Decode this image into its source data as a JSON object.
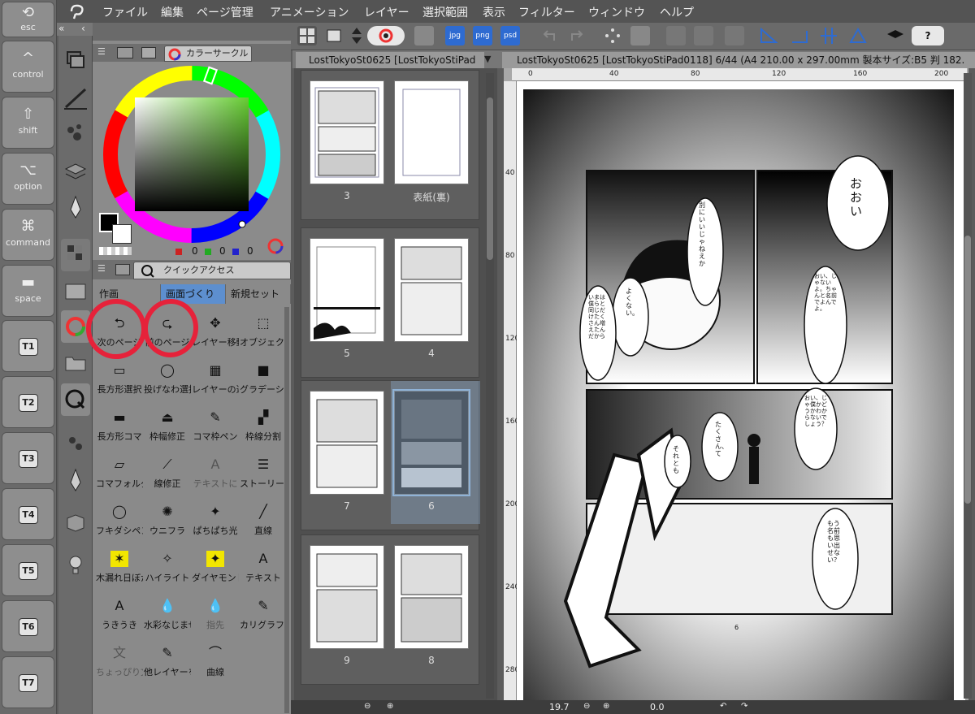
{
  "keys": [
    {
      "glyph": "⟲",
      "label": "esc"
    },
    {
      "glyph": "^",
      "label": "control"
    },
    {
      "glyph": "⇧",
      "label": "shift"
    },
    {
      "glyph": "⌥",
      "label": "option"
    },
    {
      "glyph": "⌘",
      "label": "command"
    },
    {
      "glyph": "▬",
      "label": "space"
    }
  ],
  "tkeys": [
    "T1",
    "T2",
    "T3",
    "T4",
    "T5",
    "T6",
    "T7"
  ],
  "menu": [
    "ファイル",
    "編集",
    "ページ管理",
    "アニメーション",
    "レイヤー",
    "選択範囲",
    "表示",
    "フィルター",
    "ウィンドウ",
    "ヘルプ"
  ],
  "color_panel": {
    "tab_label": "カラーサークル",
    "rgb": [
      "0",
      "0",
      "0"
    ],
    "colors": {
      "hue_ring_start": "#ff0000",
      "square_top_right": "#66cc33",
      "red": "#c22",
      "green": "#2a2",
      "blue": "#22c"
    }
  },
  "quick_access": {
    "tab_label": "クイックアクセス",
    "sets": [
      "作画",
      "画面づくり",
      "新規セット"
    ],
    "items": [
      {
        "icon": "prev-page-icon",
        "label": "次のページ"
      },
      {
        "icon": "next-page-icon",
        "label": "前のページ"
      },
      {
        "icon": "move-layer-icon",
        "label": "レイヤー移動"
      },
      {
        "icon": "object-icon",
        "label": "オブジェクト"
      },
      {
        "icon": "rect-select-icon",
        "label": "長方形選択"
      },
      {
        "icon": "lasso-select-icon",
        "label": "投げなわ選択"
      },
      {
        "icon": "layer-select-icon",
        "label": "レイヤーの選択"
      },
      {
        "icon": "gradient-icon",
        "label": "グラデーション"
      },
      {
        "icon": "rect-frame-icon",
        "label": "長方形コマ"
      },
      {
        "icon": "border-fix-icon",
        "label": "枠幅修正"
      },
      {
        "icon": "frame-pen-icon",
        "label": "コマ枠ペン"
      },
      {
        "icon": "frame-split-icon",
        "label": "枠線分割"
      },
      {
        "icon": "frame-folder-icon",
        "label": "コマフォルダー"
      },
      {
        "icon": "line-fix-icon",
        "label": "線修正"
      },
      {
        "icon": "text-icon",
        "label": "テキストに"
      },
      {
        "icon": "story-icon",
        "label": "ストーリーエディタ"
      },
      {
        "icon": "balloon-icon",
        "label": "フキダシペン"
      },
      {
        "icon": "uni-flash-icon",
        "label": "ウニフラ"
      },
      {
        "icon": "sparkle-icon",
        "label": "ぱちぱち光"
      },
      {
        "icon": "line-icon",
        "label": "直線"
      },
      {
        "icon": "leaf-light-icon",
        "label": "木漏れ日ぼかし"
      },
      {
        "icon": "highlight-icon",
        "label": "ハイライト"
      },
      {
        "icon": "diamond-icon",
        "label": "ダイヤモンド"
      },
      {
        "icon": "text-tool-icon",
        "label": "テキスト"
      },
      {
        "icon": "wobble-text-icon",
        "label": "うきうき"
      },
      {
        "icon": "watercolor-icon",
        "label": "水彩なじませ"
      },
      {
        "icon": "finger-icon",
        "label": "指先"
      },
      {
        "icon": "calligraphy-icon",
        "label": "カリグラフィ"
      },
      {
        "icon": "char-icon",
        "label": "ちょっぴり文字"
      },
      {
        "icon": "other-layer-icon",
        "label": "他レイヤーを"
      },
      {
        "icon": "curve-icon",
        "label": "曲線"
      }
    ]
  },
  "page_list": {
    "tab_label": "LostTokyoSt0625 [LostTokyoStiPad",
    "spreads": [
      {
        "left": "3",
        "right": "表紙(裏)"
      },
      {
        "left": "5",
        "right": "4"
      },
      {
        "left": "7",
        "right": "6"
      },
      {
        "left": "9",
        "right": "8"
      }
    ],
    "selected": "6"
  },
  "canvas": {
    "tab_label": "LostTokyoSt0625 [LostTokyoStiPad0118] 6/44 (A4 210.00 x 297.00mm 製本サイズ:B5 判 182.",
    "ruler_x": [
      "0",
      "40",
      "80",
      "120",
      "160",
      "200"
    ],
    "ruler_y": [
      "40",
      "80",
      "120",
      "160",
      "200",
      "240",
      "280"
    ],
    "page_number": "6",
    "balloons": [
      "おおい",
      "別にいいじゃねえか",
      "よくない。",
      "いまは僕らと同じだけたくさん増えたんだから",
      "おい、じゃないよ。ちゃんと名前でよんでよ。",
      "おい、じゃ僕かどうかわからないでしょう？",
      "たくさん、て",
      "それとも",
      "もう名前も思い出せない？"
    ]
  },
  "status": {
    "zoom": "19.7",
    "angle": "0.0"
  }
}
